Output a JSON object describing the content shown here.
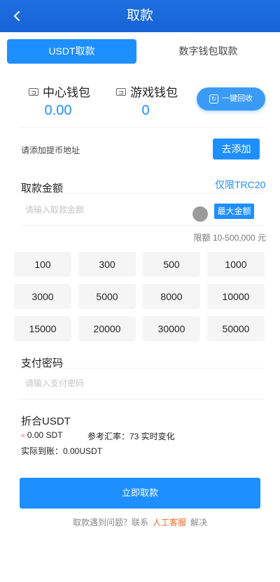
{
  "header": {
    "title": "取款",
    "back_icon": "‹"
  },
  "tabs": [
    {
      "label": "USDT取款",
      "active": true
    },
    {
      "label": "数字钱包取款",
      "active": false
    }
  ],
  "wallets": [
    {
      "name": "中心钱包",
      "value": "0.00"
    },
    {
      "name": "游戏钱包",
      "value": "0"
    }
  ],
  "recycle": {
    "label": "一键回收",
    "icon": "refresh-icon"
  },
  "address": {
    "prompt": "请添加提币地址",
    "add_label": "去添加"
  },
  "amount": {
    "title": "取款金额",
    "network_note": "仅限TRC20",
    "placeholder": "请输入取款金额",
    "max_label": "最大金额",
    "limit": "限额 10-500,000 元"
  },
  "quick_amounts": [
    "100",
    "300",
    "500",
    "1000",
    "3000",
    "5000",
    "8000",
    "10000",
    "15000",
    "20000",
    "30000",
    "50000"
  ],
  "password": {
    "title": "支付密码",
    "placeholder": "请输入支付密码"
  },
  "usdt": {
    "title": "折合USDT",
    "approx_symbol": "≈",
    "amount": "0.00 SDT",
    "rate": "参考汇率：73 实时变化",
    "actual": "实际到账：0.00USDT"
  },
  "submit_label": "立即取款",
  "help": {
    "prefix": "取款遇到问题？联系",
    "link": "人工客服",
    "suffix": "解决"
  },
  "colors": {
    "primary": "#1e8fff",
    "header": "#1563d6",
    "service": "#e76a2a"
  }
}
